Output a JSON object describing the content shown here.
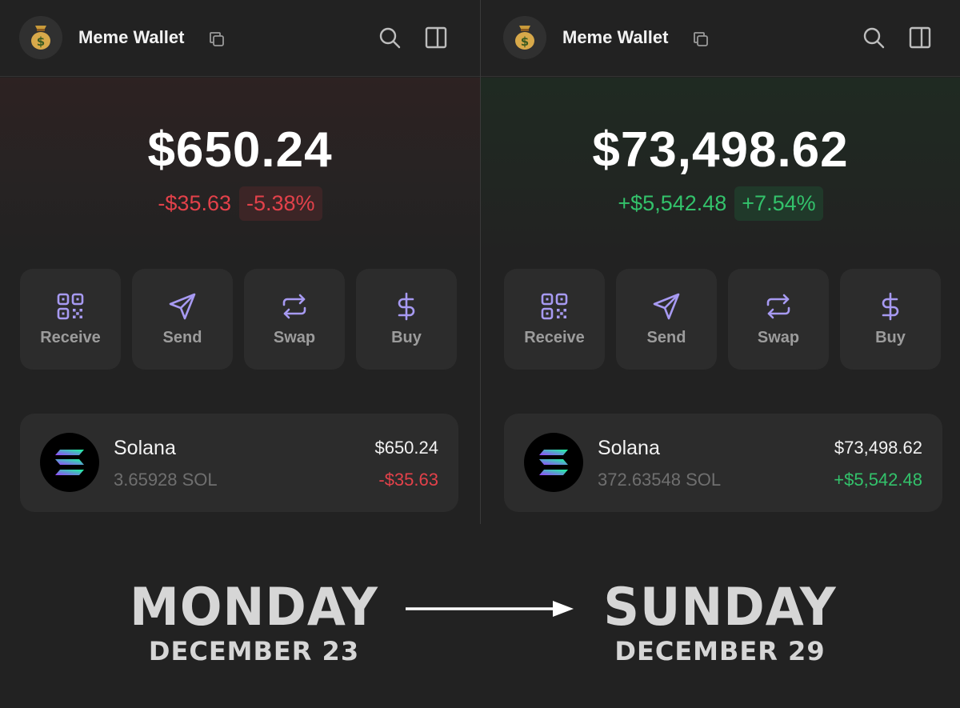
{
  "colors": {
    "background": "#222222",
    "card": "#2c2c2c",
    "accent_purple": "#a79af2",
    "negative": "#e3414a",
    "positive": "#33c26b"
  },
  "panels": [
    {
      "wallet_name": "Meme Wallet",
      "avatar_icon": "money-bag-icon",
      "balance": "$650.24",
      "change_value": "-$35.63",
      "change_percent": "-5.38%",
      "trend": "negative",
      "actions": [
        {
          "label": "Receive",
          "icon": "qr-code-icon"
        },
        {
          "label": "Send",
          "icon": "send-icon"
        },
        {
          "label": "Swap",
          "icon": "swap-icon"
        },
        {
          "label": "Buy",
          "icon": "dollar-icon"
        }
      ],
      "token": {
        "name": "Solana",
        "amount": "3.65928 SOL",
        "value": "$650.24",
        "change": "-$35.63"
      }
    },
    {
      "wallet_name": "Meme Wallet",
      "avatar_icon": "money-bag-icon",
      "balance": "$73,498.62",
      "change_value": "+$5,542.48",
      "change_percent": "+7.54%",
      "trend": "positive",
      "actions": [
        {
          "label": "Receive",
          "icon": "qr-code-icon"
        },
        {
          "label": "Send",
          "icon": "send-icon"
        },
        {
          "label": "Swap",
          "icon": "swap-icon"
        },
        {
          "label": "Buy",
          "icon": "dollar-icon"
        }
      ],
      "token": {
        "name": "Solana",
        "amount": "372.63548 SOL",
        "value": "$73,498.62",
        "change": "+$5,542.48"
      }
    }
  ],
  "caption": {
    "from_day": "MONDAY",
    "from_date": "DECEMBER 23",
    "to_day": "SUNDAY",
    "to_date": "DECEMBER 29"
  }
}
